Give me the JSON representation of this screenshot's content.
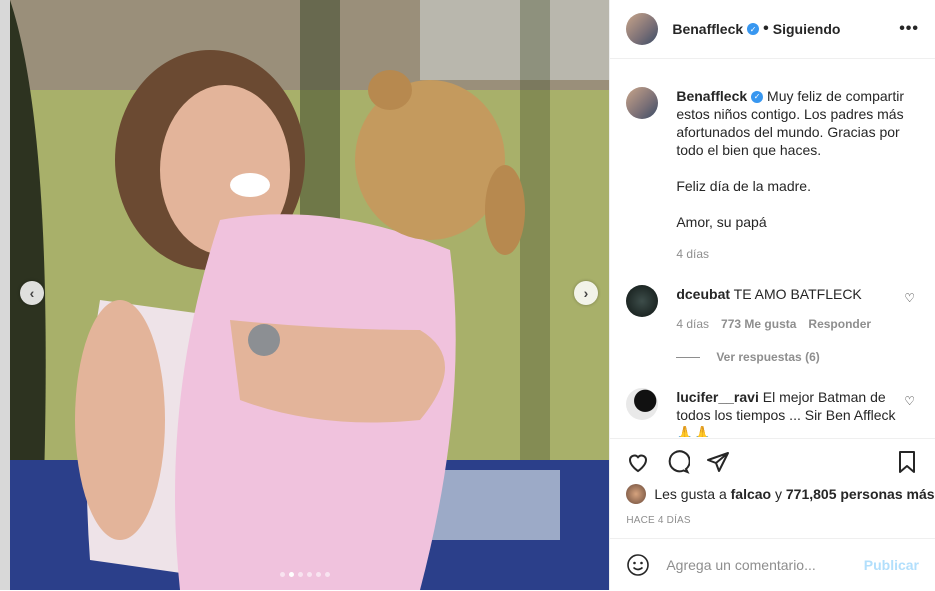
{
  "post": {
    "username": "Benaffleck",
    "follow_status": "Siguiendo",
    "caption_lines": [
      "Muy feliz de compartir estos niños contigo. Los padres más afortunados del mundo. Gracias por todo el bien que haces.",
      "Feliz día de la madre.",
      "Amor, su papá"
    ],
    "caption_time": "4 días"
  },
  "comments": [
    {
      "user": "dceubat",
      "text": "TE AMO BATFLECK",
      "time": "4 días",
      "likes": "773 Me gusta",
      "reply": "Responder",
      "view_replies": "Ver respuestas (6)"
    },
    {
      "user": "lucifer__ravi",
      "text": "El mejor Batman de todos los tiempos ... Sir Ben Affleck 🙏🙏"
    }
  ],
  "likes": {
    "prefix": "Les gusta a",
    "user": "falcao",
    "conj": "y",
    "count": "771,805 personas más"
  },
  "date": "HACE 4 DÍAS",
  "add_comment": {
    "placeholder": "Agrega un comentario...",
    "publish": "Publicar"
  },
  "carousel": {
    "count": 6,
    "active": 1
  },
  "icons": {
    "heart": "heart-icon",
    "comment": "comment-icon",
    "share": "share-icon",
    "bookmark": "bookmark-icon",
    "emoji": "emoji-icon"
  },
  "colors": {
    "verified": "#3897f0",
    "publish": "#b2dffc",
    "muted": "#8e8e8e"
  }
}
